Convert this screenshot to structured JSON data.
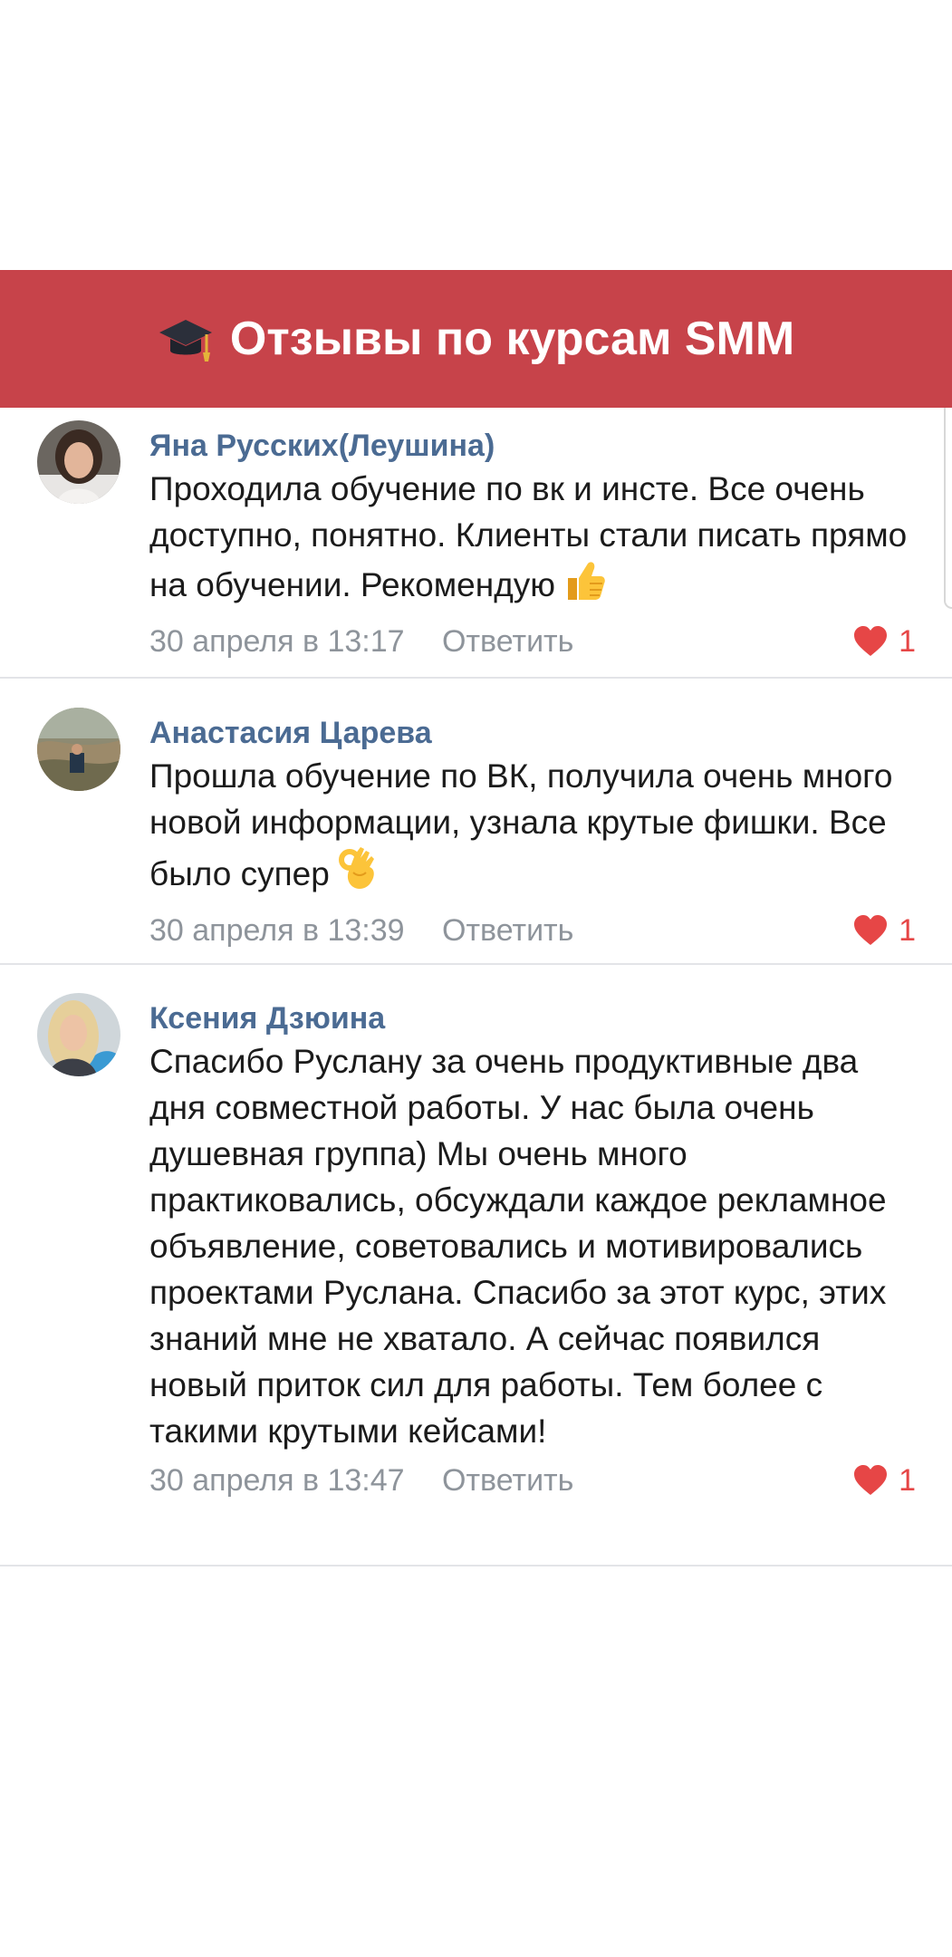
{
  "header": {
    "title": "Отзывы по курсам SMM",
    "icon": "graduation-cap-icon",
    "background_color": "#c7434a"
  },
  "comments": [
    {
      "author": "Яна Русских(Леушина)",
      "text": "Проходила обучение по вк и инсте. Все очень доступно, понятно. Клиенты стали писать прямо на обучении. Рекомендую",
      "emoji": "thumbs-up-icon",
      "date": "30 апреля в 13:17",
      "reply_label": "Ответить",
      "likes": "1"
    },
    {
      "author": "Анастасия Царева",
      "text": "Прошла обучение по ВК, получила очень много новой информации, узнала крутые фишки. Все было супер",
      "emoji": "ok-hand-icon",
      "date": "30 апреля в 13:39",
      "reply_label": "Ответить",
      "likes": "1"
    },
    {
      "author": "Ксения Дзюина",
      "text": "Спасибо Руслану за очень продуктивные два дня совместной работы. У нас была очень душевная группа) Мы очень много практиковались, обсуждали каждое рекламное объявление, советовались и мотивировались проектами Руслана. Спасибо за этот курс, этих знаний мне не хватало. А сейчас появился новый приток сил для работы. Тем более с такими крутыми кейсами!",
      "emoji": "",
      "date": "30 апреля в 13:47",
      "reply_label": "Ответить",
      "likes": "1"
    }
  ],
  "colors": {
    "author": "#4b6b93",
    "meta": "#8e949b",
    "like": "#e64646"
  }
}
